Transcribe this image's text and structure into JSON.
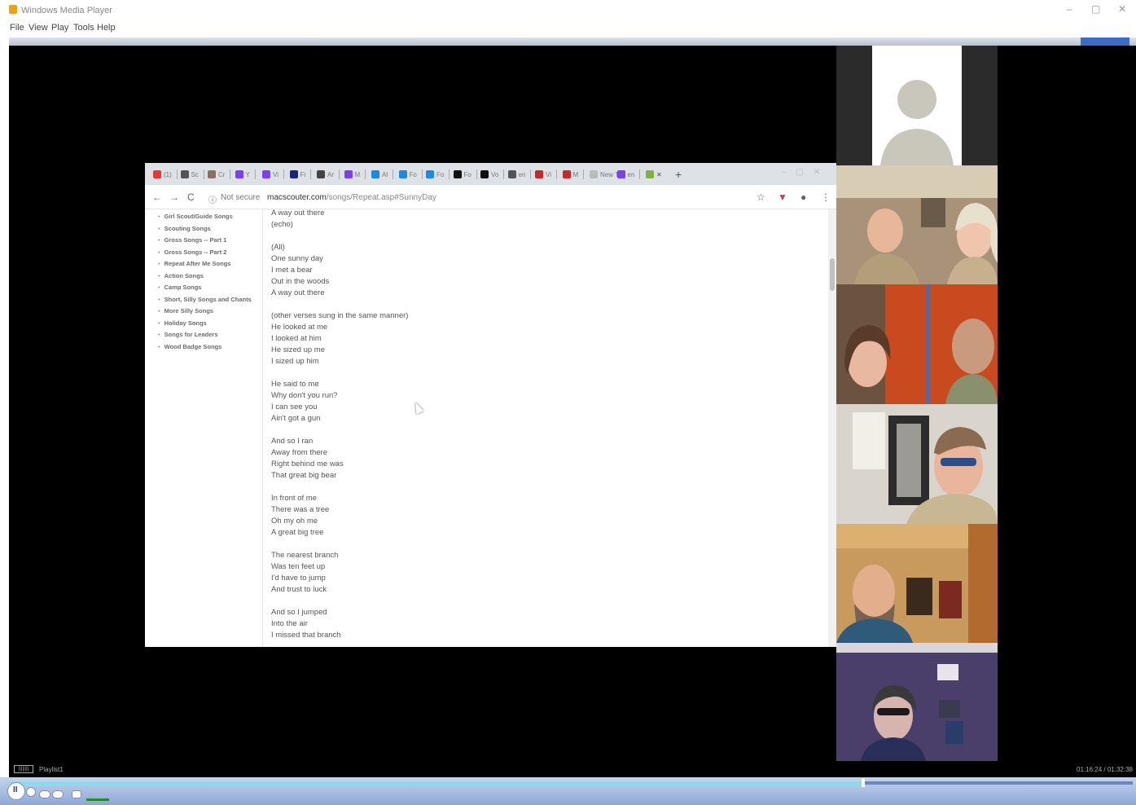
{
  "window": {
    "title": "Windows Media Player",
    "controls": [
      "–",
      "▢",
      "✕"
    ]
  },
  "menu": [
    "File",
    "View",
    "Play",
    "Tools",
    "Help"
  ],
  "browser": {
    "tabs": [
      {
        "label": "(1)",
        "color": "#e53935"
      },
      {
        "label": "Sc",
        "color": "#555555"
      },
      {
        "label": "Cr",
        "color": "#8d6e63"
      },
      {
        "label": "Y",
        "color": "#7e3ff2"
      },
      {
        "label": "Vi",
        "color": "#7e3ff2"
      },
      {
        "label": "Fi",
        "color": "#1a237e"
      },
      {
        "label": "Ar",
        "color": "#444444"
      },
      {
        "label": "M",
        "color": "#7e3ff2"
      },
      {
        "label": "Al",
        "color": "#1e88e5"
      },
      {
        "label": "Fo",
        "color": "#1e88e5"
      },
      {
        "label": "Fo",
        "color": "#1e88e5"
      },
      {
        "label": "Fo",
        "color": "#111111"
      },
      {
        "label": "Vo",
        "color": "#111111"
      },
      {
        "label": "en",
        "color": "#555555"
      },
      {
        "label": "Vi",
        "color": "#c62828"
      },
      {
        "label": "M",
        "color": "#c62828"
      },
      {
        "label": "New T",
        "color": "#bbbbbb"
      },
      {
        "label": "en",
        "color": "#7e3ff2"
      }
    ],
    "active_tab_close": "✕",
    "new_tab": "+",
    "address": {
      "secure_label": "Not secure",
      "host": "macscouter.com",
      "path": "/songs/Repeat.asp#SunnyDay"
    }
  },
  "sidebar_links": [
    "Girl Scout/Guide Songs",
    "Scouting Songs",
    "Gross Songs -- Part 1",
    "Gross Songs -- Part 2",
    "Repeat After Me Songs",
    "Action Songs",
    "Camp Songs",
    "Short, Silly Songs and Chants",
    "More Silly Songs",
    "Holiday Songs",
    "Songs for Leaders",
    "Wood Badge Songs"
  ],
  "lyrics": [
    [
      "A way out there",
      "(echo)"
    ],
    [
      "(All)",
      "One sunny day",
      "I met a bear",
      "Out in the woods",
      "A way out there"
    ],
    [
      "(other verses sung in the same manner)",
      "He looked at me",
      "I looked at him",
      "He sized up me",
      "I sized up him"
    ],
    [
      "He said to me",
      "Why don't you run?",
      "I can see you",
      "Ain't got a gun"
    ],
    [
      "And so I ran",
      "Away from there",
      "Right behind me was",
      "That great big bear"
    ],
    [
      "In front of me",
      "There was a tree",
      "Oh my oh me",
      "A great big tree"
    ],
    [
      "The nearest branch",
      "Was ten feet up",
      "I'd have to jump",
      "And trust to luck"
    ],
    [
      "And so I jumped",
      "Into the air",
      "I missed that branch"
    ]
  ],
  "player": {
    "playlist_badge": "||||||||",
    "playlist_label": "Playlist1",
    "time": "01:16:24 / 01:32:38",
    "progress": 0.76
  }
}
